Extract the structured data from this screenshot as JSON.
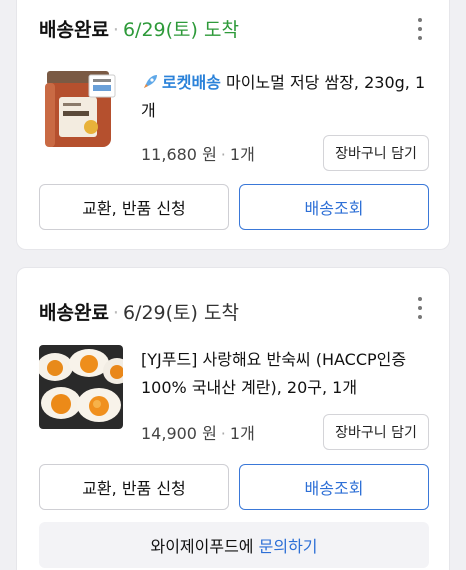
{
  "orders": [
    {
      "status": "배송완료",
      "date": "6/29(토) 도착",
      "date_color": "#2e9a3a",
      "rocket_label": "로켓배송",
      "product_name": "마이노멀 저당 쌈장, 230g, 1개",
      "price": "11,680 원",
      "quantity": "1개",
      "cart_button": "장바구니 담기",
      "exchange_button": "교환, 반품 신청",
      "track_button": "배송조회",
      "thumbnail_icon": "ssamjang-jar-image"
    },
    {
      "status": "배송완료",
      "date": "6/29(토) 도착",
      "date_color": "#333333",
      "product_name": "[YJ푸드] 사랑해요 반숙씨 (HACCP인증 100% 국내산 계란), 20구, 1개",
      "price": "14,900 원",
      "quantity": "1개",
      "cart_button": "장바구니 담기",
      "exchange_button": "교환, 반품 신청",
      "track_button": "배송조회",
      "thumbnail_icon": "boiled-eggs-image",
      "inquiry_prefix": "와이제이푸드에 ",
      "inquiry_link": "문의하기"
    }
  ],
  "colors": {
    "accent_blue": "#2d6fd6",
    "rocket_blue": "#2b82d9",
    "delivered_green": "#2e9a3a"
  }
}
